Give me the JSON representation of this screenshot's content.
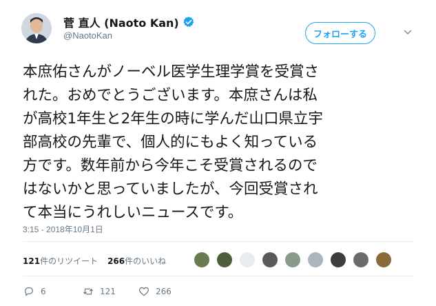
{
  "user": {
    "name": "菅 直人 (Naoto Kan)",
    "handle": "@NaotoKan",
    "verified": true
  },
  "follow_button_label": "フォローする",
  "tweet": {
    "lines": [
      "本庶佑さんがノーベル医学生理学賞を受賞さ",
      "れた。おめでとうございます。本庶さんは私",
      "が高校1年生と2年生の時に学んだ山口県立宇",
      "部高校の先輩で、個人的にもよく知っている",
      "方です。数年前から今年こそ受賞されるので",
      "はないかと思っていましたが、今回受賞され",
      "て本当にうれしいニュースです。"
    ],
    "timestamp": "3:15 - 2018年10月1日"
  },
  "stats": {
    "retweets_count": "121",
    "retweets_label": "件のリツイート",
    "likes_count": "266",
    "likes_label": "件のいいね"
  },
  "actions": {
    "reply_count": "6",
    "retweet_count": "121",
    "like_count": "266"
  },
  "colors": {
    "accent": "#1da1f2",
    "muted": "#657786"
  },
  "icons": {
    "verified": "verified-badge-icon",
    "menu": "chevron-down-icon",
    "reply": "reply-icon",
    "retweet": "retweet-icon",
    "like": "heart-icon"
  }
}
